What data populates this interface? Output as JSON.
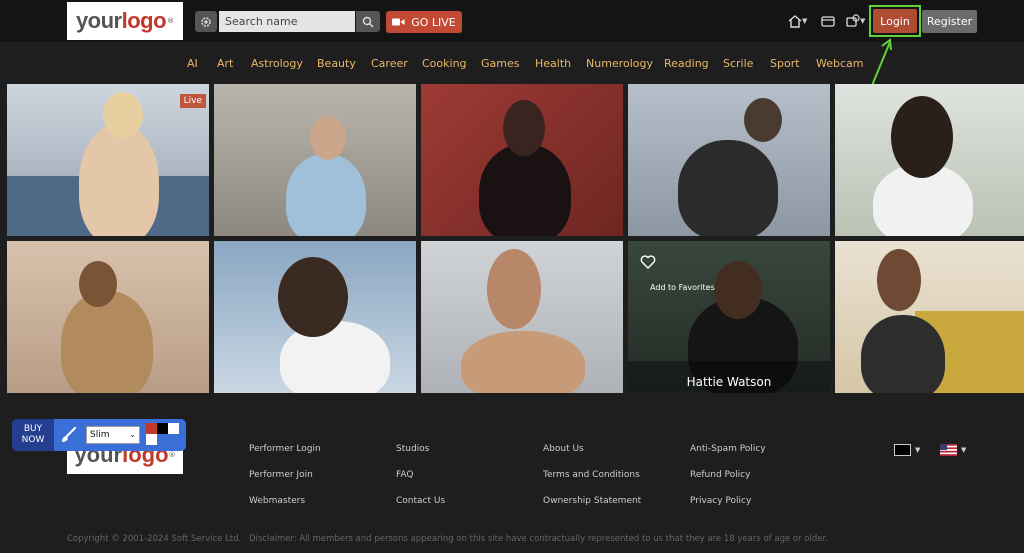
{
  "header": {
    "logo_text_1": "your",
    "logo_text_2": "logo",
    "logo_mark": "®",
    "search_placeholder": "Search name",
    "golive_label": "GO LIVE",
    "login_label": "Login",
    "register_label": "Register",
    "icons": [
      "home-icon",
      "wallet-icon",
      "camera-settings-icon"
    ]
  },
  "categories": [
    "AI",
    "Art",
    "Astrology",
    "Beauty",
    "Career",
    "Cooking",
    "Games",
    "Health",
    "Numerology",
    "Reading",
    "Scrile",
    "Sport",
    "Webcam"
  ],
  "grid": {
    "live_badge": "Live",
    "add_to_favorites": "Add to Favorites",
    "hovered_name": "Hattie Watson"
  },
  "footer": {
    "buy_now_line1": "BUY",
    "buy_now_line2": "NOW",
    "theme_select": "Slim",
    "links": [
      [
        "Performer Login",
        "Performer Join",
        "Webmasters"
      ],
      [
        "Studios",
        "FAQ",
        "Contact Us"
      ],
      [
        "About Us",
        "Terms and Conditions",
        "Ownership Statement"
      ],
      [
        "Anti-Spam Policy",
        "Refund Policy",
        "Privacy Policy"
      ]
    ],
    "copyright": "Copyright © 2001-2024 Soft Service Ltd.",
    "disclaimer": "Disclaimer: All members and persons appearing on this site have contractually represented to us that they are 18 years of age or older."
  },
  "colors": {
    "accent_red": "#c24a34",
    "category_gold": "#e8b86a",
    "highlight_green": "#5fd13a",
    "buy_now_blue": "#243f8f"
  }
}
